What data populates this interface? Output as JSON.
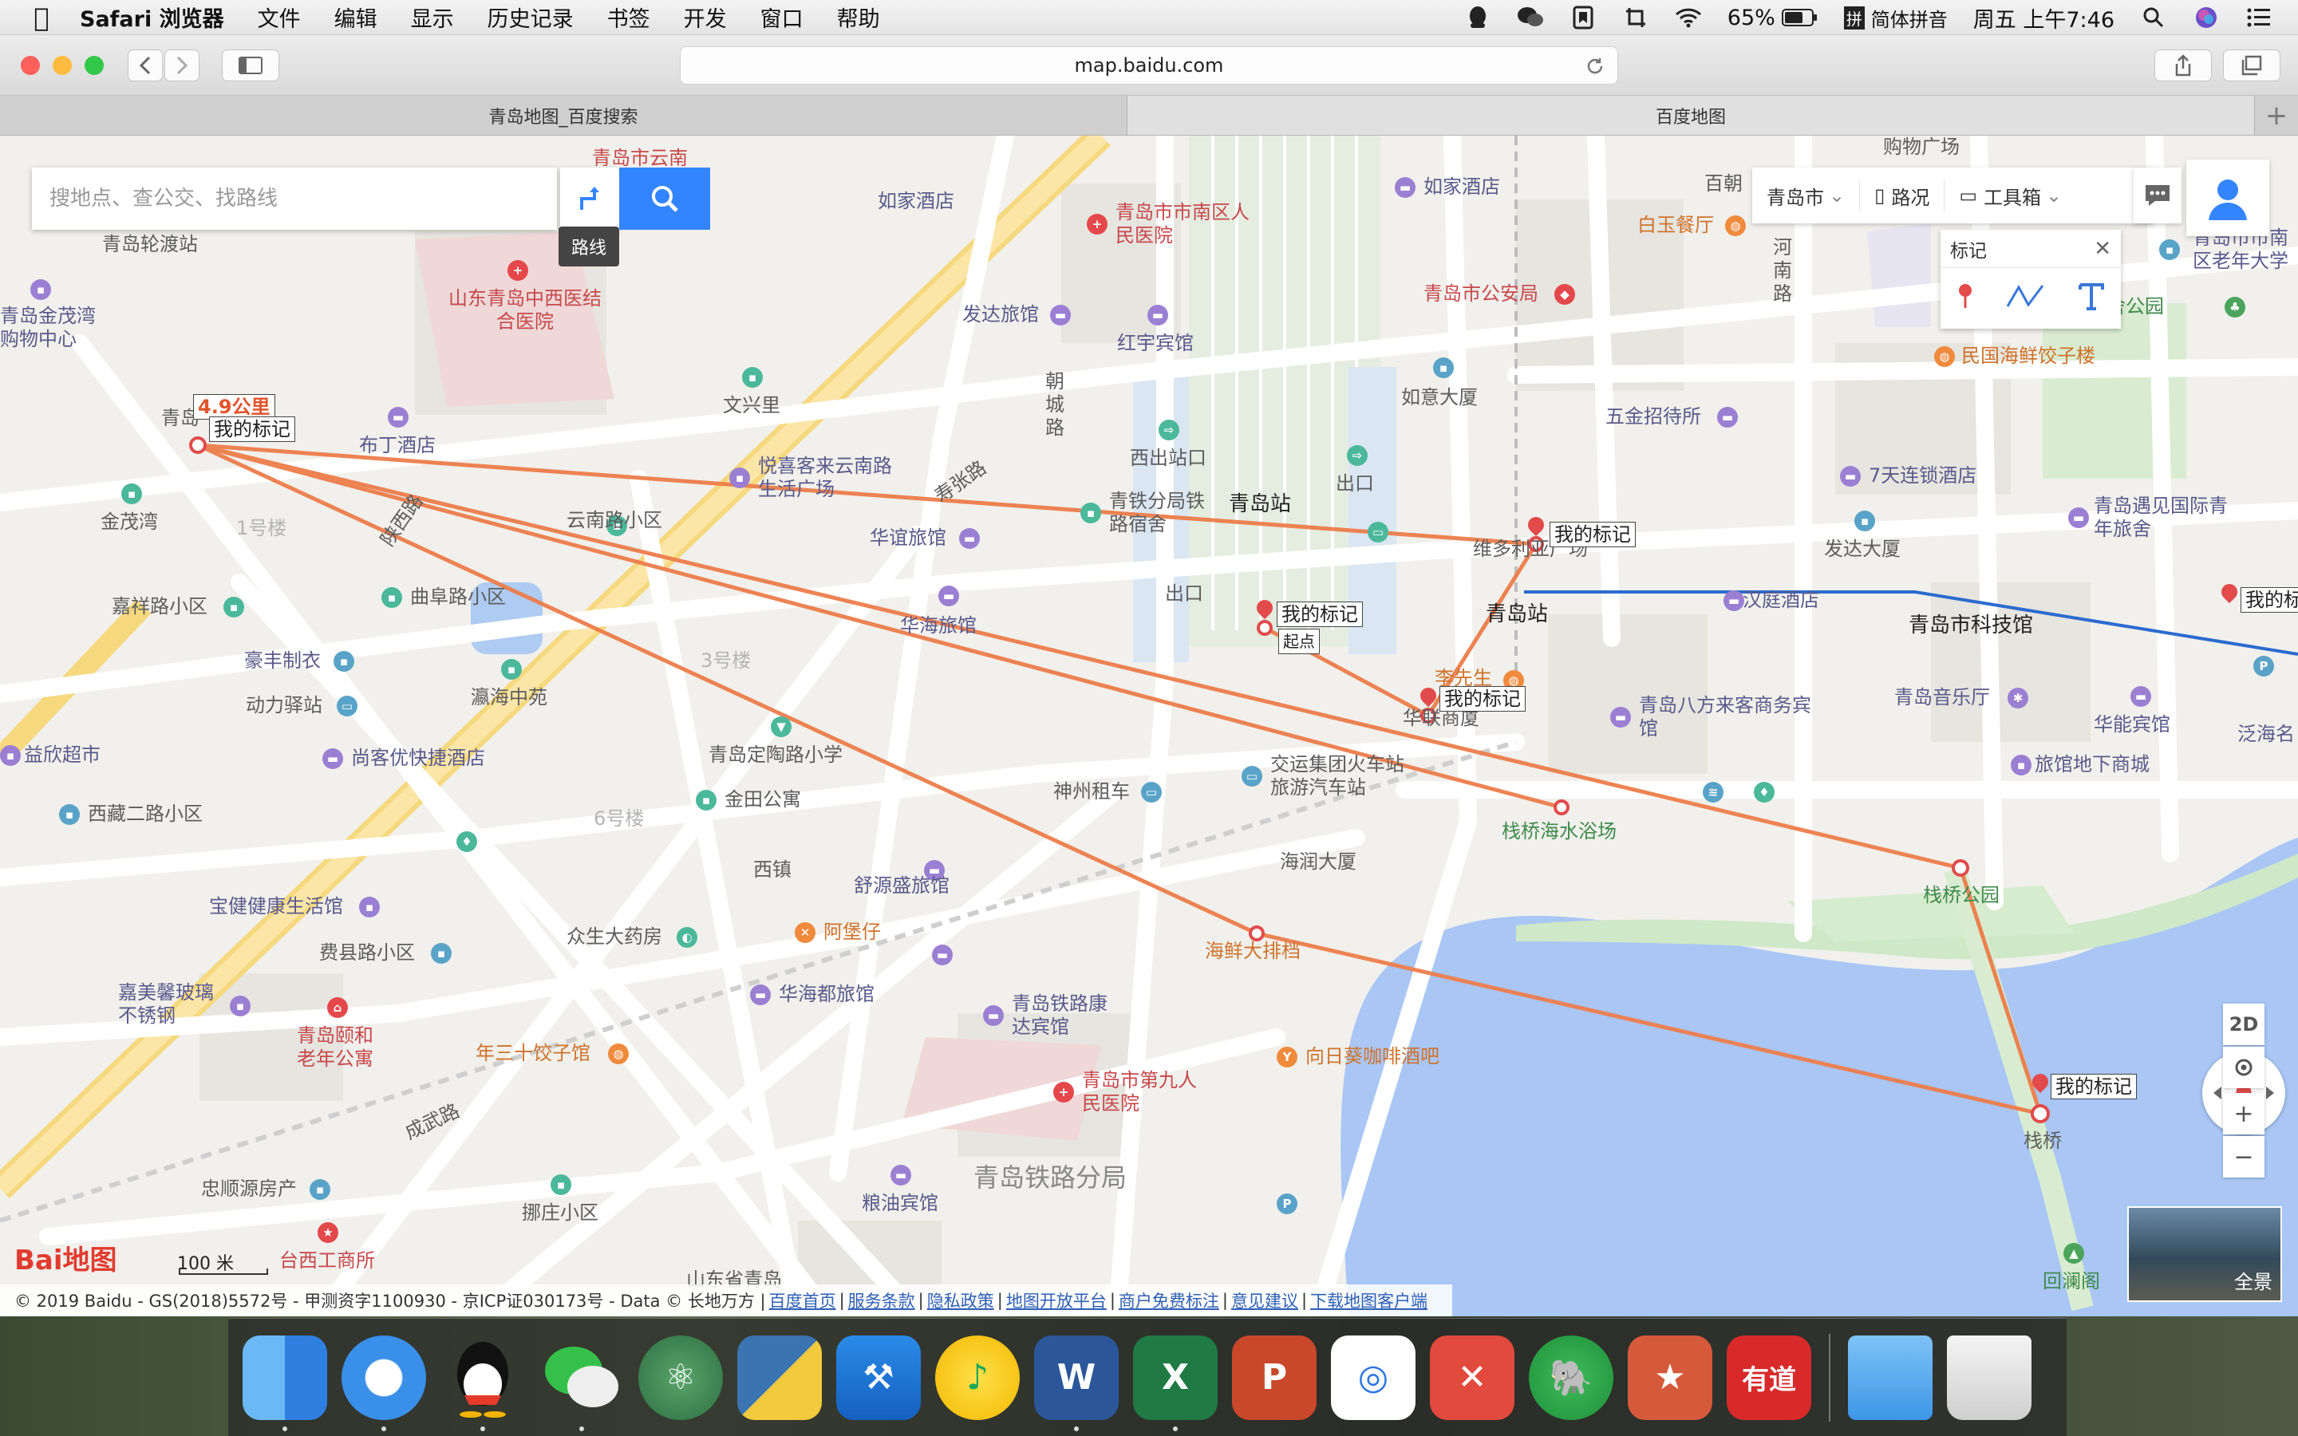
{
  "menubar": {
    "app": "Safari 浏览器",
    "items": [
      "文件",
      "编辑",
      "显示",
      "历史记录",
      "书签",
      "开发",
      "窗口",
      "帮助"
    ],
    "battery": "65%",
    "input_method": "简体拼音",
    "clock": "周五 上午7:46"
  },
  "browser": {
    "url": "map.baidu.com",
    "tabs": [
      {
        "title": "青岛地图_百度搜索",
        "active": false
      },
      {
        "title": "百度地图",
        "active": true
      }
    ]
  },
  "map": {
    "search_placeholder": "搜地点、查公交、找路线",
    "route_tooltip": "路线",
    "city": "青岛市",
    "traffic": "路况",
    "toolbox": "工具箱",
    "mark_panel_title": "标记",
    "distance_label": "4.9公里",
    "marker_label": "我的标记",
    "start_label": "起点",
    "view_2d": "2D",
    "zoom_in": "+",
    "zoom_out": "−",
    "panorama": "全景",
    "scale": "100 米",
    "logo": "Bai地图",
    "copyright": "© 2019 Baidu - GS(2018)5572号 - 甲测资字1100930 - 京ICP证030173号 - Data © 长地万方 |",
    "footer_links": [
      "百度首页",
      "服务条款",
      "隐私政策",
      "地图开放平台",
      "商户免费标注",
      "意见建议",
      "下载地图客户端"
    ],
    "labels": {
      "l1": "青岛轮渡站",
      "l2": "青岛市云南",
      "l3": "如家酒店",
      "l4": "青岛市市南区人民医院",
      "l5": "如家酒店",
      "l6": "百朝",
      "l7": "购物广场",
      "l8": "青岛市市南区老年大学",
      "l9": "山东青岛中西医结合医院",
      "l10": "白玉餐厅",
      "l11": "青岛市公安局",
      "l12": "老舍公园",
      "l13": "青岛金茂湾购物中心",
      "l14": "发达旅馆",
      "l15": "红宇宾馆",
      "l16": "民国海鲜饺子楼",
      "l17": "文兴里",
      "l18": "朝城路",
      "l19": "如意大厦",
      "l20": "五金招待所",
      "l21": "布丁酒店",
      "l22": "西出站口",
      "l23": "出口",
      "l24": "7天连锁酒店",
      "l25": "金茂湾",
      "l26": "悦喜客来云南路生活广场",
      "l27": "青铁分局铁路宿舍",
      "l28": "青岛站",
      "l29": "青岛遇见国际青年旅舍",
      "l30": "云南路小区",
      "l31": "华谊旅馆",
      "l32": "发达大厦",
      "l33": "嘉祥路小区",
      "l34": "曲阜路小区",
      "l35": "出口",
      "l36": "维多利亚广场",
      "l37": "汉庭酒店",
      "l38": "青岛站",
      "l39": "青岛市科技馆",
      "l40": "豪丰制衣",
      "l41": "华海旅馆",
      "l42": "瀛海中苑",
      "l43": "动力驿站",
      "l44": "尚客优快捷酒店",
      "l45": "青岛八方来客商务宾馆",
      "l46": "青岛音乐厅",
      "l47": "华能宾馆",
      "l48": "泛海名",
      "l49": "益欣超市",
      "l50": "青岛定陶路小学",
      "l51": "交运集团火车站旅游汽车站",
      "l52": "旅馆地下商城",
      "l53": "西藏二路小区",
      "l54": "金田公寓",
      "l55": "神州租车",
      "l56": "栈桥海水浴场",
      "l57": "海润大厦",
      "l58": "栈桥公园",
      "l59": "宝健健康生活馆",
      "l60": "西镇",
      "l61": "舒源盛旅馆",
      "l62": "众生大药房",
      "l63": "阿堡仔",
      "l64": "费县路小区",
      "l65": "海鲜大排档",
      "l66": "嘉美馨玻璃不锈钢",
      "l67": "青岛颐和老年公寓",
      "l68": "华海都旅馆",
      "l69": "青岛铁路康达宾馆",
      "l70": "年三十饺子馆",
      "l71": "向日葵咖啡酒吧",
      "l72": "青岛市第九人民医院",
      "l73": "成武路",
      "l74": "栈桥",
      "l75": "忠顺源房产",
      "l76": "青岛铁路分局",
      "l77": "挪庄小区",
      "l78": "粮油宾馆",
      "l79": "台西工商所",
      "l80": "回澜阁",
      "l81": "山东省青岛",
      "l82": "寿张路",
      "l83": "陕西路",
      "l84": "河南路",
      "l85": "1号楼",
      "l86": "3号楼",
      "l87": "6号楼",
      "l88": "青岛",
      "l89": "华联商厦",
      "l90": "李先生"
    }
  }
}
